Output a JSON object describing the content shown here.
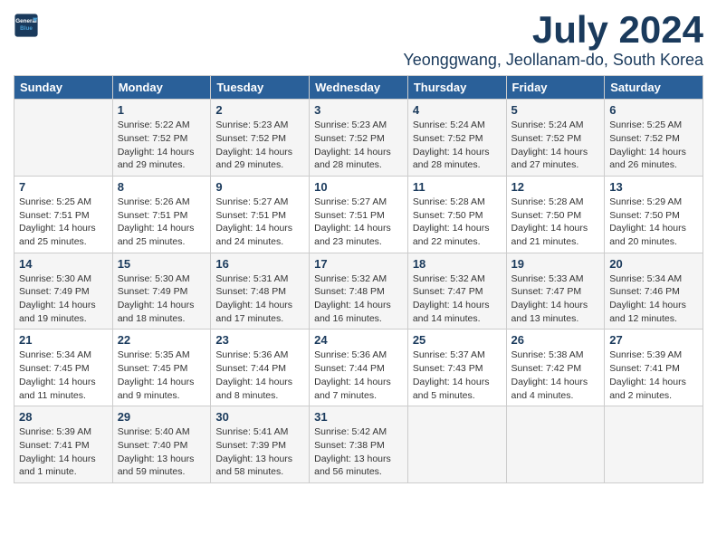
{
  "logo": {
    "line1": "General",
    "line2": "Blue"
  },
  "title": "July 2024",
  "location": "Yeonggwang, Jeollanam-do, South Korea",
  "weekdays": [
    "Sunday",
    "Monday",
    "Tuesday",
    "Wednesday",
    "Thursday",
    "Friday",
    "Saturday"
  ],
  "weeks": [
    [
      {
        "day": "",
        "info": ""
      },
      {
        "day": "1",
        "info": "Sunrise: 5:22 AM\nSunset: 7:52 PM\nDaylight: 14 hours\nand 29 minutes."
      },
      {
        "day": "2",
        "info": "Sunrise: 5:23 AM\nSunset: 7:52 PM\nDaylight: 14 hours\nand 29 minutes."
      },
      {
        "day": "3",
        "info": "Sunrise: 5:23 AM\nSunset: 7:52 PM\nDaylight: 14 hours\nand 28 minutes."
      },
      {
        "day": "4",
        "info": "Sunrise: 5:24 AM\nSunset: 7:52 PM\nDaylight: 14 hours\nand 28 minutes."
      },
      {
        "day": "5",
        "info": "Sunrise: 5:24 AM\nSunset: 7:52 PM\nDaylight: 14 hours\nand 27 minutes."
      },
      {
        "day": "6",
        "info": "Sunrise: 5:25 AM\nSunset: 7:52 PM\nDaylight: 14 hours\nand 26 minutes."
      }
    ],
    [
      {
        "day": "7",
        "info": "Sunrise: 5:25 AM\nSunset: 7:51 PM\nDaylight: 14 hours\nand 25 minutes."
      },
      {
        "day": "8",
        "info": "Sunrise: 5:26 AM\nSunset: 7:51 PM\nDaylight: 14 hours\nand 25 minutes."
      },
      {
        "day": "9",
        "info": "Sunrise: 5:27 AM\nSunset: 7:51 PM\nDaylight: 14 hours\nand 24 minutes."
      },
      {
        "day": "10",
        "info": "Sunrise: 5:27 AM\nSunset: 7:51 PM\nDaylight: 14 hours\nand 23 minutes."
      },
      {
        "day": "11",
        "info": "Sunrise: 5:28 AM\nSunset: 7:50 PM\nDaylight: 14 hours\nand 22 minutes."
      },
      {
        "day": "12",
        "info": "Sunrise: 5:28 AM\nSunset: 7:50 PM\nDaylight: 14 hours\nand 21 minutes."
      },
      {
        "day": "13",
        "info": "Sunrise: 5:29 AM\nSunset: 7:50 PM\nDaylight: 14 hours\nand 20 minutes."
      }
    ],
    [
      {
        "day": "14",
        "info": "Sunrise: 5:30 AM\nSunset: 7:49 PM\nDaylight: 14 hours\nand 19 minutes."
      },
      {
        "day": "15",
        "info": "Sunrise: 5:30 AM\nSunset: 7:49 PM\nDaylight: 14 hours\nand 18 minutes."
      },
      {
        "day": "16",
        "info": "Sunrise: 5:31 AM\nSunset: 7:48 PM\nDaylight: 14 hours\nand 17 minutes."
      },
      {
        "day": "17",
        "info": "Sunrise: 5:32 AM\nSunset: 7:48 PM\nDaylight: 14 hours\nand 16 minutes."
      },
      {
        "day": "18",
        "info": "Sunrise: 5:32 AM\nSunset: 7:47 PM\nDaylight: 14 hours\nand 14 minutes."
      },
      {
        "day": "19",
        "info": "Sunrise: 5:33 AM\nSunset: 7:47 PM\nDaylight: 14 hours\nand 13 minutes."
      },
      {
        "day": "20",
        "info": "Sunrise: 5:34 AM\nSunset: 7:46 PM\nDaylight: 14 hours\nand 12 minutes."
      }
    ],
    [
      {
        "day": "21",
        "info": "Sunrise: 5:34 AM\nSunset: 7:45 PM\nDaylight: 14 hours\nand 11 minutes."
      },
      {
        "day": "22",
        "info": "Sunrise: 5:35 AM\nSunset: 7:45 PM\nDaylight: 14 hours\nand 9 minutes."
      },
      {
        "day": "23",
        "info": "Sunrise: 5:36 AM\nSunset: 7:44 PM\nDaylight: 14 hours\nand 8 minutes."
      },
      {
        "day": "24",
        "info": "Sunrise: 5:36 AM\nSunset: 7:44 PM\nDaylight: 14 hours\nand 7 minutes."
      },
      {
        "day": "25",
        "info": "Sunrise: 5:37 AM\nSunset: 7:43 PM\nDaylight: 14 hours\nand 5 minutes."
      },
      {
        "day": "26",
        "info": "Sunrise: 5:38 AM\nSunset: 7:42 PM\nDaylight: 14 hours\nand 4 minutes."
      },
      {
        "day": "27",
        "info": "Sunrise: 5:39 AM\nSunset: 7:41 PM\nDaylight: 14 hours\nand 2 minutes."
      }
    ],
    [
      {
        "day": "28",
        "info": "Sunrise: 5:39 AM\nSunset: 7:41 PM\nDaylight: 14 hours\nand 1 minute."
      },
      {
        "day": "29",
        "info": "Sunrise: 5:40 AM\nSunset: 7:40 PM\nDaylight: 13 hours\nand 59 minutes."
      },
      {
        "day": "30",
        "info": "Sunrise: 5:41 AM\nSunset: 7:39 PM\nDaylight: 13 hours\nand 58 minutes."
      },
      {
        "day": "31",
        "info": "Sunrise: 5:42 AM\nSunset: 7:38 PM\nDaylight: 13 hours\nand 56 minutes."
      },
      {
        "day": "",
        "info": ""
      },
      {
        "day": "",
        "info": ""
      },
      {
        "day": "",
        "info": ""
      }
    ]
  ]
}
